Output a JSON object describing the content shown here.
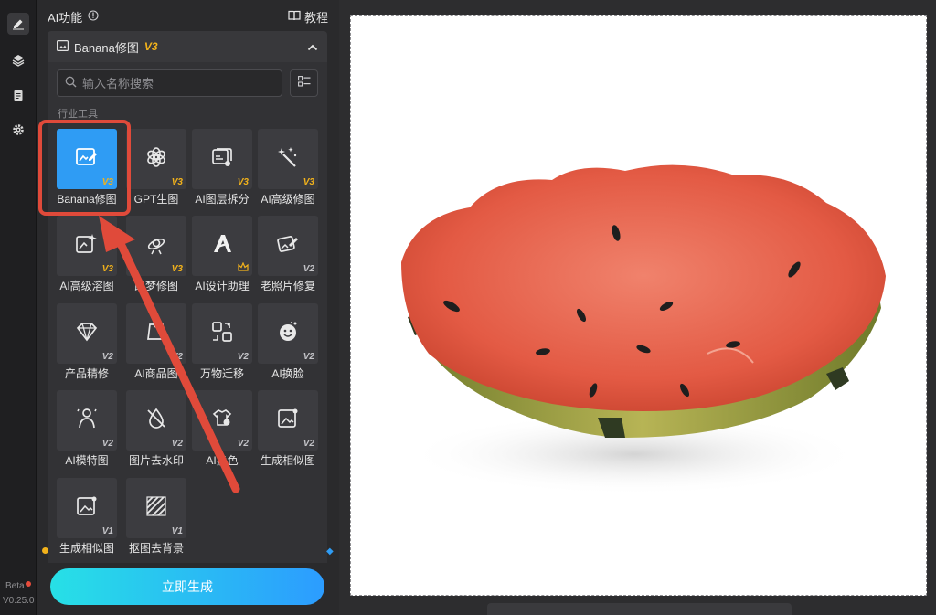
{
  "rail": {
    "icons": [
      "edit-icon",
      "layers-icon",
      "clipboard-icon",
      "gear-icon"
    ],
    "beta": "Beta",
    "version": "V0.25.0"
  },
  "panel": {
    "title": "AI功能",
    "tutorial": "教程",
    "tool_group": {
      "name": "Banana修图",
      "version": "V3"
    },
    "search_placeholder": "输入名称搜索",
    "section": "行业工具",
    "tools": [
      {
        "label": "Banana修图",
        "badge": "V3",
        "icon": "image-edit-icon",
        "selected": true
      },
      {
        "label": "GPT生图",
        "badge": "V3",
        "icon": "openai-icon"
      },
      {
        "label": "AI图层拆分",
        "badge": "V3",
        "icon": "layer-split-icon"
      },
      {
        "label": "AI高级修图",
        "badge": "V3",
        "icon": "magic-wand-icon"
      },
      {
        "label": "AI高级溶图",
        "badge": "V3",
        "icon": "image-sparkle-icon"
      },
      {
        "label": "即梦修图",
        "badge": "V3",
        "icon": "satellite-icon"
      },
      {
        "label": "AI设计助理",
        "badge": "crown",
        "icon": "design-a-icon"
      },
      {
        "label": "老照片修复",
        "badge": "V2",
        "icon": "photo-restore-icon"
      },
      {
        "label": "产品精修",
        "badge": "V2",
        "icon": "diamond-icon"
      },
      {
        "label": "AI商品图",
        "badge": "V2",
        "icon": "product-image-icon"
      },
      {
        "label": "万物迁移",
        "badge": "V2",
        "icon": "transfer-icon"
      },
      {
        "label": "AI换脸",
        "badge": "V2",
        "icon": "face-swap-icon"
      },
      {
        "label": "AI模特图",
        "badge": "V2",
        "icon": "model-person-icon"
      },
      {
        "label": "图片去水印",
        "badge": "V2",
        "icon": "watermark-remove-icon"
      },
      {
        "label": "AI换色",
        "badge": "V2",
        "icon": "recolor-icon"
      },
      {
        "label": "生成相似图",
        "badge": "V2",
        "icon": "similar-image-icon"
      },
      {
        "label": "生成相似图",
        "badge": "V1",
        "icon": "similar-image-v1-icon"
      },
      {
        "label": "抠图去背景",
        "badge": "V1",
        "icon": "remove-bg-icon"
      }
    ],
    "generate_button": "立即生成"
  },
  "colors": {
    "accent": "#2f9cf4",
    "badge_gold": "#f2b21b",
    "annotation_red": "#e04a3a",
    "button_gradient_start": "#27e0e6",
    "button_gradient_end": "#2c9cff"
  },
  "canvas": {
    "image_subject": "watermelon-style-ceramic-bowl"
  }
}
